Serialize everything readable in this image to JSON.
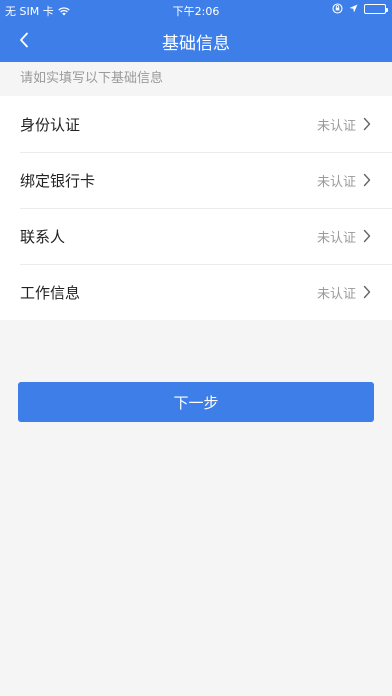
{
  "status_bar": {
    "carrier": "无 SIM 卡",
    "time": "下午2:06",
    "battery_color": "#4cd964"
  },
  "nav": {
    "back_icon": "chevron-left-icon",
    "title": "基础信息"
  },
  "hint": "请如实填写以下基础信息",
  "items": [
    {
      "label": "身份认证",
      "status": "未认证"
    },
    {
      "label": "绑定银行卡",
      "status": "未认证"
    },
    {
      "label": "联系人",
      "status": "未认证"
    },
    {
      "label": "工作信息",
      "status": "未认证"
    }
  ],
  "next_button": {
    "label": "下一步"
  },
  "colors": {
    "primary": "#3d7ee8",
    "background": "#f5f5f5",
    "muted_text": "#9a9a9a"
  }
}
